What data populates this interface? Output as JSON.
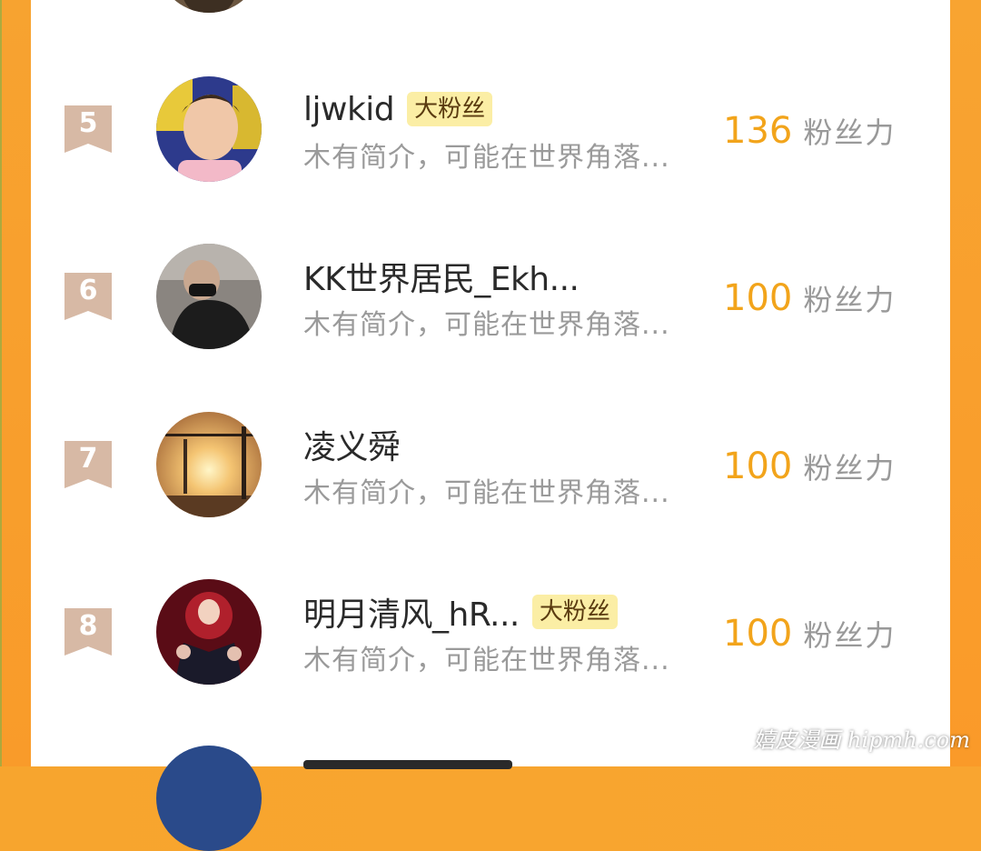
{
  "colors": {
    "accent_orange": "#f9a530",
    "score_color": "#f2a41b",
    "rank_ribbon": "#d7b9a5",
    "badge_bg": "#fbeea5",
    "name_color": "#2a2a2a",
    "intro_color": "#9a9a9a"
  },
  "unit_label": "粉丝力",
  "rows": [
    {
      "rank": "5",
      "name": "ljwkid",
      "badge": "大粉丝",
      "intro": "木有简介，可能在世界角落...",
      "score": "136",
      "avatar_icon": "child-photo-avatar"
    },
    {
      "rank": "6",
      "name": "KK世界居民_Ekh...",
      "badge": "",
      "intro": "木有简介，可能在世界角落...",
      "score": "100",
      "avatar_icon": "masked-person-avatar"
    },
    {
      "rank": "7",
      "name": "凌义舜",
      "badge": "",
      "intro": "木有简介，可能在世界角落...",
      "score": "100",
      "avatar_icon": "sunset-crane-avatar"
    },
    {
      "rank": "8",
      "name": "明月清风_hR...",
      "badge": "大粉丝",
      "intro": "木有简介，可能在世界角落...",
      "score": "100",
      "avatar_icon": "anime-art-avatar"
    }
  ],
  "watermark": "嬉皮漫画 hipmh.com"
}
